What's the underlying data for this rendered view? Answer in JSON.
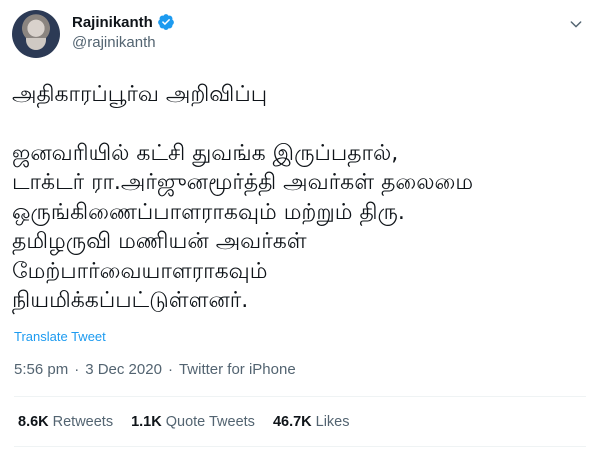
{
  "author": {
    "display_name": "Rajinikanth",
    "handle": "@rajinikanth",
    "verified_icon": "verified-badge-icon",
    "brand_color": "#1d9bf0"
  },
  "tweet": {
    "lines": [
      "அதிகாரப்பூர்வ அறிவிப்பு",
      "ஜனவரியில் கட்சி துவங்க இருப்பதால்,",
      "டாக்டர் ரா.அர்ஜுனமூர்த்தி அவர்கள் தலைமை",
      "ஒருங்கிணைப்பாளராகவும் மற்றும் திரு.",
      "தமிழருவி மணியன் அவர்கள்",
      "மேற்பார்வையாளராகவும்",
      "நியமிக்கப்பட்டுள்ளனர்."
    ],
    "translate_label": "Translate Tweet",
    "time": "5:56 pm",
    "date": "3 Dec 2020",
    "source": "Twitter for iPhone",
    "separator": "·"
  },
  "stats": {
    "retweets_count": "8.6K",
    "retweets_label": "Retweets",
    "quotes_count": "1.1K",
    "quotes_label": "Quote Tweets",
    "likes_count": "46.7K",
    "likes_label": "Likes"
  }
}
